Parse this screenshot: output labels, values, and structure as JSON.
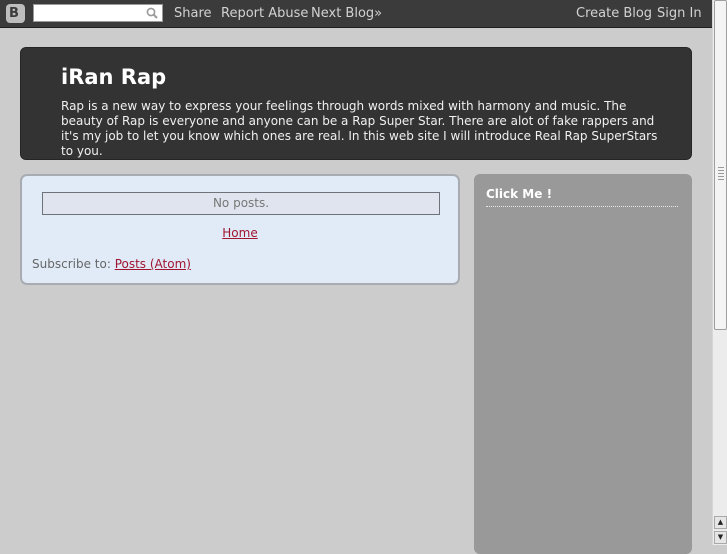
{
  "navbar": {
    "logo_icon": "blogger-b-icon",
    "search_placeholder": "",
    "search_value": "",
    "links_left": [
      "Share",
      "Report Abuse",
      "Next Blog»"
    ],
    "links_right": [
      "Create Blog",
      "Sign In"
    ]
  },
  "header": {
    "title": "iRan Rap",
    "description": "Rap is a new way to express your feelings through words mixed with harmony and music. The beauty of Rap is everyone and anyone can be a Rap Super Star. There are alot of fake rappers and it's my job to let you know which ones are real. In this web site I will introduce Real Rap SuperStars to you."
  },
  "main": {
    "no_posts": "No posts.",
    "home_link": "Home",
    "subscribe_label": "Subscribe to:",
    "subscribe_link": "Posts (Atom)"
  },
  "sidebar": {
    "widget_title": "Click Me !"
  },
  "colors": {
    "page_bg": "#cccccc",
    "navbar_bg": "#3b3b3b",
    "header_bg": "#333333",
    "main_bg": "#e1ebf8",
    "sidebar_bg": "#999999",
    "link": "#a01530"
  }
}
